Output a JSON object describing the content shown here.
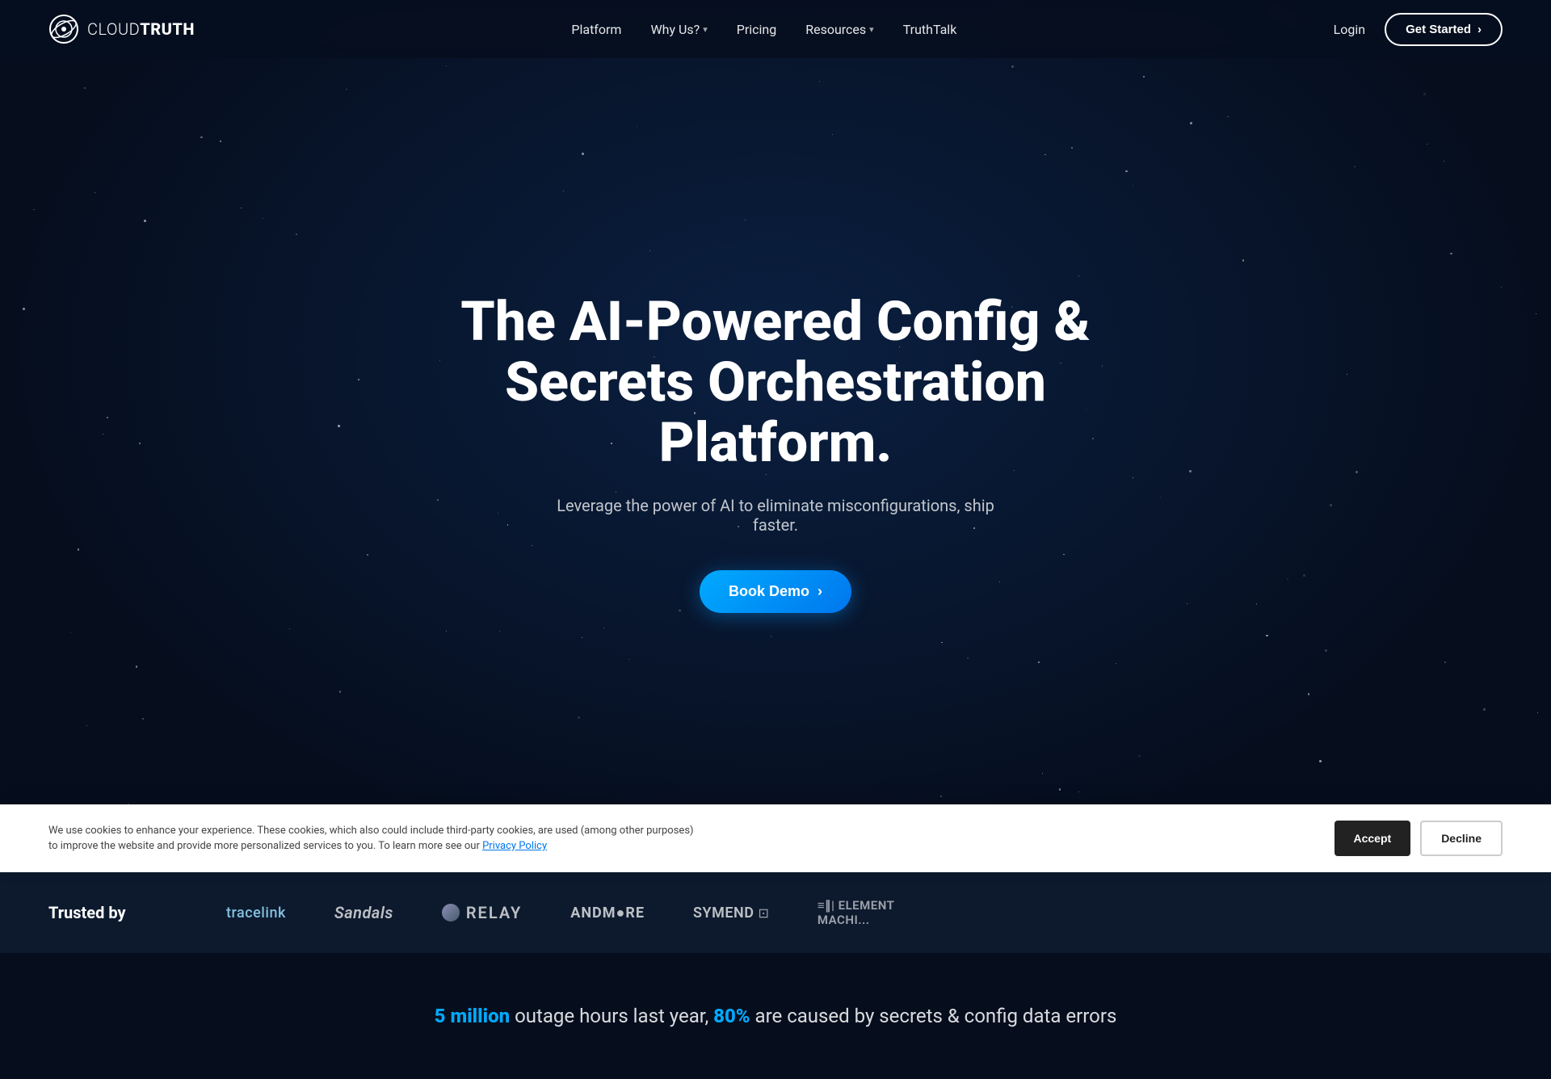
{
  "brand": {
    "name_part1": "CLOUD",
    "name_part2": "TRUTH",
    "logo_alt": "CloudTruth Logo"
  },
  "nav": {
    "links": [
      {
        "label": "Platform",
        "has_dropdown": false
      },
      {
        "label": "Why Us?",
        "has_dropdown": true
      },
      {
        "label": "Pricing",
        "has_dropdown": false
      },
      {
        "label": "Resources",
        "has_dropdown": true
      },
      {
        "label": "TruthTalk",
        "has_dropdown": false
      }
    ],
    "login_label": "Login",
    "cta_label": "Get Started",
    "cta_arrow": "›"
  },
  "hero": {
    "headline": "The AI-Powered Config & Secrets Orchestration Platform.",
    "subheadline": "Leverage the power of AI to eliminate misconfigurations, ship faster.",
    "cta_label": "Book Demo",
    "cta_arrow": "›"
  },
  "trusted": {
    "label": "Trusted by",
    "logos": [
      {
        "id": "tracelink",
        "text": "tracelink"
      },
      {
        "id": "sandals",
        "text": "Sandals"
      },
      {
        "id": "relay",
        "text": "RELAY"
      },
      {
        "id": "andmore",
        "text": "ANDM●RE"
      },
      {
        "id": "symend",
        "text": "SYMEND"
      },
      {
        "id": "element",
        "text": "≡Ⅱ‖ ELEMENT\nMACHI..."
      }
    ]
  },
  "stats": {
    "highlight1": "5 million",
    "text1": " outage hours last year, ",
    "highlight2": "80%",
    "text2": " are caused by secrets & config data errors"
  },
  "cookie": {
    "text": "We use cookies to enhance your experience. These cookies, which also could include third-party cookies, are used (among other purposes) to improve the website and provide more personalized services to you. To learn more see our ",
    "link_text": "Privacy Policy",
    "accept_label": "Accept",
    "decline_label": "Decline"
  }
}
